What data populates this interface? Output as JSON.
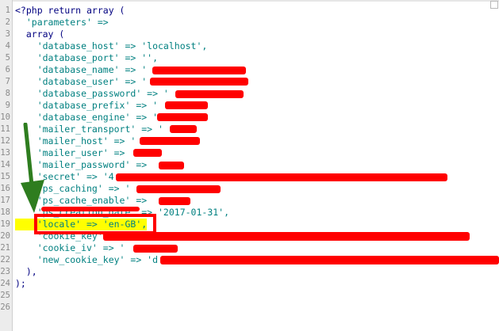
{
  "editor": {
    "lines": [
      {
        "n": "1",
        "code": "<?php return array ("
      },
      {
        "n": "2",
        "code": "  'parameters' =>"
      },
      {
        "n": "3",
        "code": "  array ("
      },
      {
        "n": "4",
        "code": "    'database_host' => 'localhost',"
      },
      {
        "n": "5",
        "code": "    'database_port' => '',"
      },
      {
        "n": "6",
        "code": "    'database_name' => '"
      },
      {
        "n": "7",
        "code": "    'database_user' => '"
      },
      {
        "n": "8",
        "code": "    'database_password' => '"
      },
      {
        "n": "9",
        "code": "    'database_prefix' => '"
      },
      {
        "n": "10",
        "code": "    'database_engine' => '"
      },
      {
        "n": "11",
        "code": "    'mailer_transport' => '"
      },
      {
        "n": "12",
        "code": "    'mailer_host' => '"
      },
      {
        "n": "13",
        "code": "    'mailer_user' => "
      },
      {
        "n": "14",
        "code": "    'mailer_password' => "
      },
      {
        "n": "15",
        "code": "    'secret' => '4"
      },
      {
        "n": "16",
        "code": "    'ps_caching' => '"
      },
      {
        "n": "17",
        "code": "    'ps_cache_enable' => "
      },
      {
        "n": "18",
        "code": "    'ps_creation_date' => '2017-01-31',"
      },
      {
        "n": "19",
        "code": "    'locale' => 'en-GB',"
      },
      {
        "n": "20",
        "code": "    'cookie_key' => '"
      },
      {
        "n": "21",
        "code": "    'cookie_iv' => '"
      },
      {
        "n": "22",
        "code": "    'new_cookie_key' => 'd"
      },
      {
        "n": "23",
        "code": "  ),"
      },
      {
        "n": "24",
        "code": ");"
      },
      {
        "n": "25",
        "code": ""
      },
      {
        "n": "26",
        "code": ""
      }
    ],
    "highlight": "'locale' => 'en-GB'",
    "annotation_color": "#ff0000",
    "arrow_color": "#2e7d1f"
  }
}
